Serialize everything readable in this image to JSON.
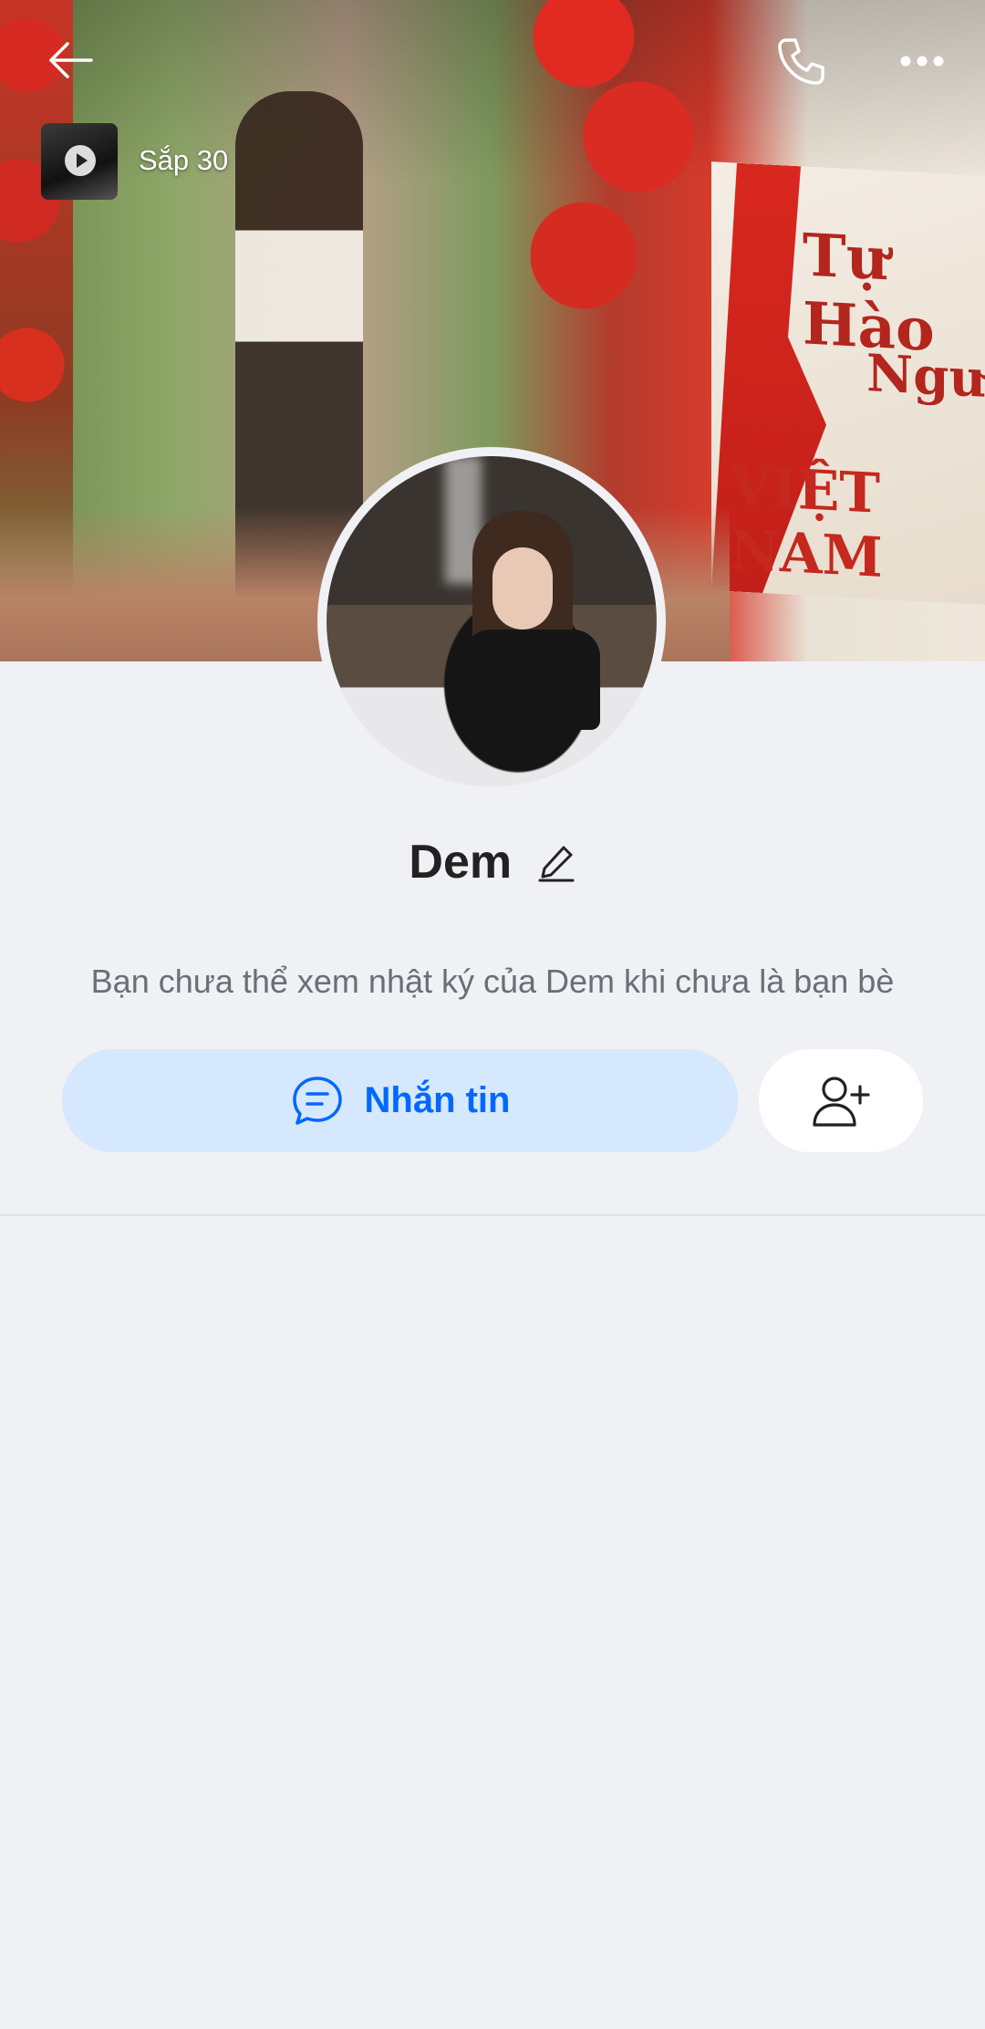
{
  "header": {
    "story_label": "Sắp 30"
  },
  "cover": {
    "sign_lines": [
      "Tự Hào",
      "Người",
      "VIỆT NAM"
    ]
  },
  "profile": {
    "name": "Dem",
    "notice": "Bạn chưa thể xem nhật ký của Dem khi chưa là bạn bè"
  },
  "actions": {
    "message_label": "Nhắn tin"
  },
  "icons": {
    "back": "arrow-left-icon",
    "call": "phone-icon",
    "more": "more-horizontal-icon",
    "edit": "pencil-icon",
    "chat": "chat-bubble-icon",
    "add_friend": "add-user-icon"
  },
  "colors": {
    "accent": "#0068ff",
    "message_button_bg": "#d6e8fd",
    "page_bg": "#f0f1f5"
  }
}
